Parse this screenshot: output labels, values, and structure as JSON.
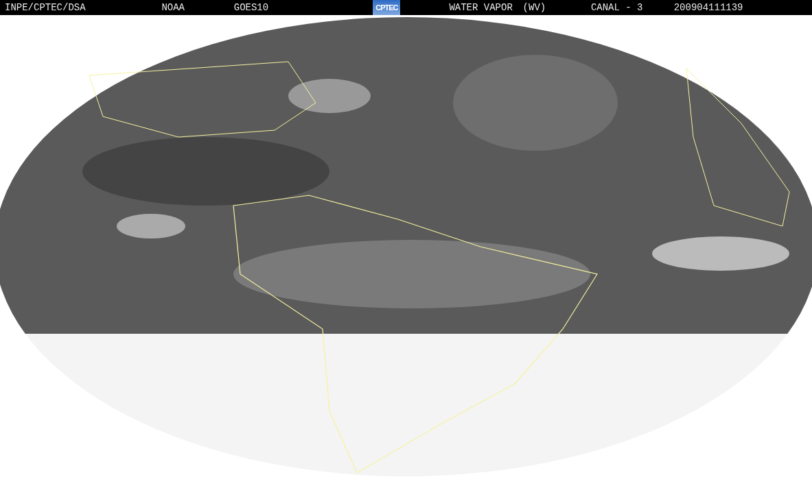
{
  "header": {
    "labels": [
      {
        "text": "INPE/CPTEC/DSA"
      },
      {
        "text": "NOAA"
      },
      {
        "text": "GOES10"
      }
    ],
    "logo": "CPTEC",
    "right_labels": [
      {
        "text": "WATER VAPOR"
      },
      {
        "text": "(WV)"
      },
      {
        "text": "CANAL - 3"
      },
      {
        "text": "200904111139"
      }
    ]
  }
}
